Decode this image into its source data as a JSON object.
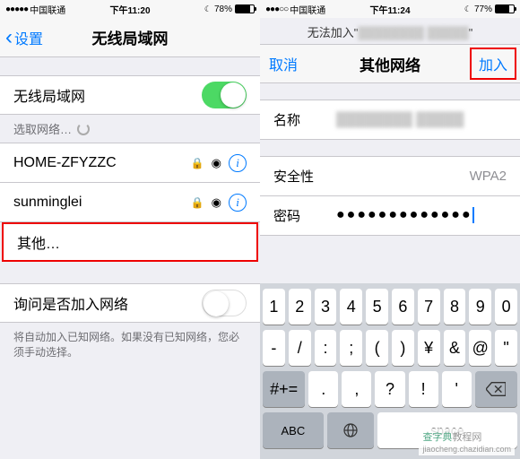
{
  "left": {
    "status": {
      "carrier": "中国联通",
      "time": "下午11:20",
      "battery": "78%",
      "batteryLevel": 78
    },
    "nav": {
      "back": "设置",
      "title": "无线局域网"
    },
    "wifiToggle": {
      "label": "无线局域网"
    },
    "choosing": "选取网络…",
    "networks": [
      {
        "name": "HOME-ZFYZZC"
      },
      {
        "name": "sunminglei"
      }
    ],
    "other": "其他…",
    "askJoin": {
      "label": "询问是否加入网络"
    },
    "footer": "将自动加入已知网络。如果没有已知网络，您必须手动选择。"
  },
  "right": {
    "status": {
      "carrier": "中国联通",
      "time": "下午11:24",
      "battery": "77%",
      "batteryLevel": 77
    },
    "error": "无法加入\"",
    "nav": {
      "cancel": "取消",
      "title": "其他网络",
      "join": "加入"
    },
    "form": {
      "nameLabel": "名称",
      "securityLabel": "安全性",
      "securityValue": "WPA2",
      "passwordLabel": "密码",
      "passwordMask": "●●●●●●●●●●●●●"
    },
    "keyboard": {
      "r1": [
        "1",
        "2",
        "3",
        "4",
        "5",
        "6",
        "7",
        "8",
        "9",
        "0"
      ],
      "r2": [
        "-",
        "/",
        ":",
        ";",
        "(",
        ")",
        "¥",
        "&",
        "@",
        "\""
      ],
      "r3s": "#+=",
      "r3": [
        ".",
        ",",
        "?",
        "!",
        "'"
      ],
      "abc": "ABC",
      "space": "space"
    }
  },
  "watermark": {
    "brand": "查字典",
    "suffix": "教程网",
    "url": "jiaocheng.chazidian.com"
  }
}
